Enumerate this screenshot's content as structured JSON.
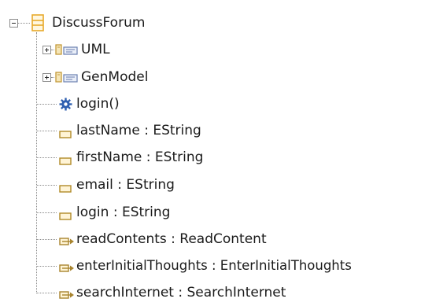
{
  "tree": {
    "root": {
      "label": "DiscussForum",
      "icon": "class-icon"
    },
    "items": [
      {
        "label": "UML",
        "icon": "annotation-icon",
        "expandable": true
      },
      {
        "label": "GenModel",
        "icon": "annotation-icon",
        "expandable": true
      },
      {
        "label": "login()",
        "icon": "operation-gear-icon"
      },
      {
        "label": "lastName : EString",
        "icon": "attribute-icon"
      },
      {
        "label": "firstName : EString",
        "icon": "attribute-icon"
      },
      {
        "label": "email : EString",
        "icon": "attribute-icon"
      },
      {
        "label": "login : EString",
        "icon": "attribute-icon"
      },
      {
        "label": "readContents : ReadContent",
        "icon": "reference-icon"
      },
      {
        "label": "enterInitialThoughts : EnterInitialThoughts",
        "icon": "reference-icon"
      },
      {
        "label": "searchInternet : SearchInternet",
        "icon": "reference-icon"
      }
    ]
  },
  "colors": {
    "class_icon": "#e8a92a",
    "annotation_icon": "#c49a3a",
    "gear_icon": "#2f5fb0",
    "attribute_icon": "#b08a28",
    "reference_icon": "#a8842e"
  }
}
